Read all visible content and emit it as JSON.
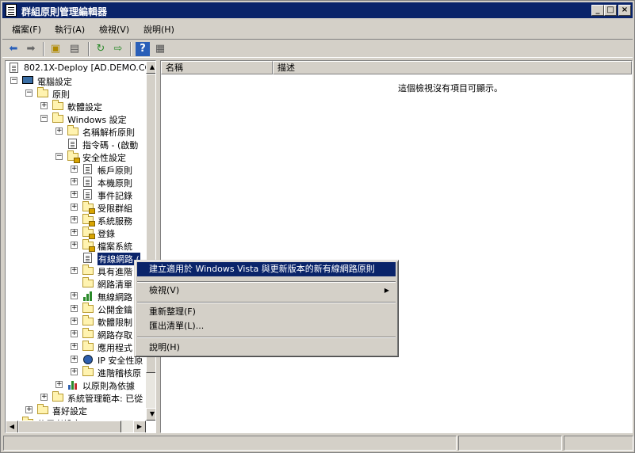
{
  "window": {
    "title": "群組原則管理編輯器",
    "buttons": {
      "minimize": "_",
      "maximize": "□",
      "close": "×"
    }
  },
  "menubar": {
    "items": [
      {
        "label": "檔案(F)"
      },
      {
        "label": "執行(A)"
      },
      {
        "label": "檢視(V)"
      },
      {
        "label": "說明(H)"
      }
    ]
  },
  "toolbar": {
    "icons": [
      "back-arrow-icon",
      "forward-arrow-icon",
      "up-folder-icon",
      "show-hide-tree-icon",
      "refresh-icon",
      "export-list-icon",
      "help-icon",
      "properties-icon"
    ]
  },
  "tree": {
    "items": [
      {
        "label": "802.1X-Deploy [AD.DEMO.CO",
        "icon": "policy-doc-icon"
      },
      {
        "label": "電腦設定",
        "icon": "computer-icon"
      },
      {
        "label": "原則",
        "icon": "folder-icon"
      },
      {
        "label": "軟體設定",
        "icon": "folder-icon"
      },
      {
        "label": "Windows 設定",
        "icon": "folder-icon"
      },
      {
        "label": "名稱解析原則",
        "icon": "folder-icon"
      },
      {
        "label": "指令碼 - (啟動",
        "icon": "script-icon"
      },
      {
        "label": "安全性設定",
        "icon": "security-folder-icon"
      },
      {
        "label": "帳戶原則",
        "icon": "doc-icon"
      },
      {
        "label": "本機原則",
        "icon": "doc-icon"
      },
      {
        "label": "事件記錄",
        "icon": "doc-icon"
      },
      {
        "label": "受限群組",
        "icon": "lock-folder-icon"
      },
      {
        "label": "系統服務",
        "icon": "lock-folder-icon"
      },
      {
        "label": "登錄",
        "icon": "lock-folder-icon"
      },
      {
        "label": "檔案系統",
        "icon": "lock-folder-icon"
      },
      {
        "label": "有線網路 (",
        "icon": "network-doc-icon"
      },
      {
        "label": "具有進階",
        "icon": "folder-icon"
      },
      {
        "label": "網路清單",
        "icon": "folder-icon"
      },
      {
        "label": "無線網路",
        "icon": "wireless-chart-icon"
      },
      {
        "label": "公開金鑰",
        "icon": "folder-icon"
      },
      {
        "label": "軟體限制",
        "icon": "folder-icon"
      },
      {
        "label": "網路存取",
        "icon": "folder-icon"
      },
      {
        "label": "應用程式",
        "icon": "folder-icon"
      },
      {
        "label": "IP 安全性原",
        "icon": "ipsec-globe-icon"
      },
      {
        "label": "進階稽核原",
        "icon": "folder-icon"
      },
      {
        "label": "以原則為依據",
        "icon": "qos-chart-icon"
      },
      {
        "label": "系統管理範本: 已從",
        "icon": "folder-icon"
      },
      {
        "label": "喜好設定",
        "icon": "folder-icon"
      },
      {
        "label": "使用者設定",
        "icon": "folder-icon"
      }
    ]
  },
  "list": {
    "columns": [
      {
        "label": "名稱"
      },
      {
        "label": "描述"
      }
    ],
    "empty_message": "這個檢視沒有項目可顯示。"
  },
  "context_menu": {
    "items": [
      {
        "label": "建立適用於 Windows Vista 與更新版本的新有線網路原則"
      },
      {
        "label": "檢視(V)"
      },
      {
        "label": "重新整理(F)"
      },
      {
        "label": "匯出清單(L)..."
      },
      {
        "label": "說明(H)"
      }
    ]
  },
  "colors": {
    "title_bar": "#0a246a",
    "highlight": "#0a246a",
    "chrome": "#d4d0c8"
  }
}
